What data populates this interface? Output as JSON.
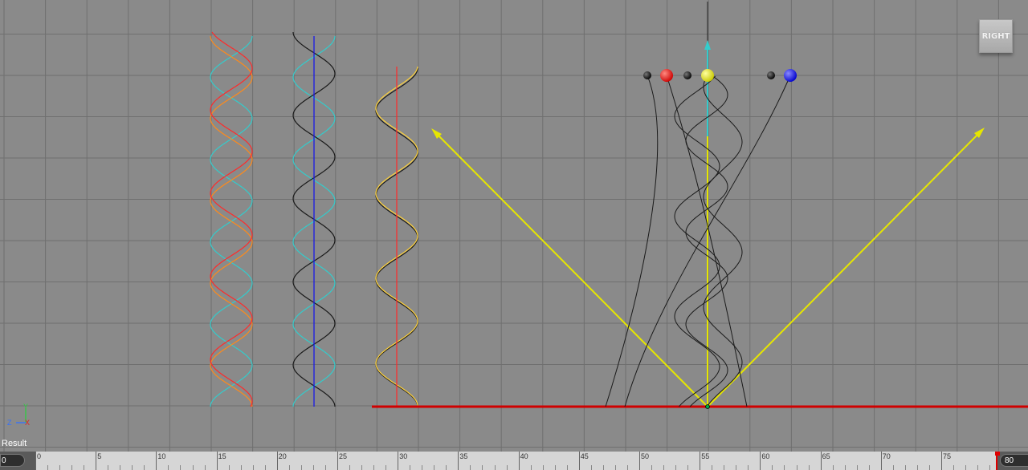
{
  "viewport": {
    "view_label": "RIGHT",
    "result_label": "Result",
    "axis_gizmo": {
      "y": "Y",
      "z": "Z",
      "x": "X"
    },
    "colors": {
      "background": "#8a8a8a",
      "grid": "#6f6f6f",
      "ground_axis": "#d00000",
      "vertical_axis": "#e6e600",
      "cyan": "#33cccc",
      "orange": "#ff8a1a",
      "red": "#ff2a2a",
      "yellow": "#ffd23a",
      "blue": "#1a1ae6",
      "black": "#1a1a1a"
    },
    "spheres": [
      {
        "color": "black"
      },
      {
        "color": "red"
      },
      {
        "color": "black"
      },
      {
        "color": "yellow"
      },
      {
        "color": "black"
      },
      {
        "color": "blue"
      }
    ]
  },
  "timeline": {
    "start_value": "0",
    "end_value": "80",
    "tick_labels": [
      "0",
      "5",
      "10",
      "15",
      "20",
      "25",
      "30",
      "35",
      "40",
      "45",
      "50",
      "55",
      "60",
      "65",
      "70",
      "75"
    ],
    "current_frame_marker": "0"
  }
}
